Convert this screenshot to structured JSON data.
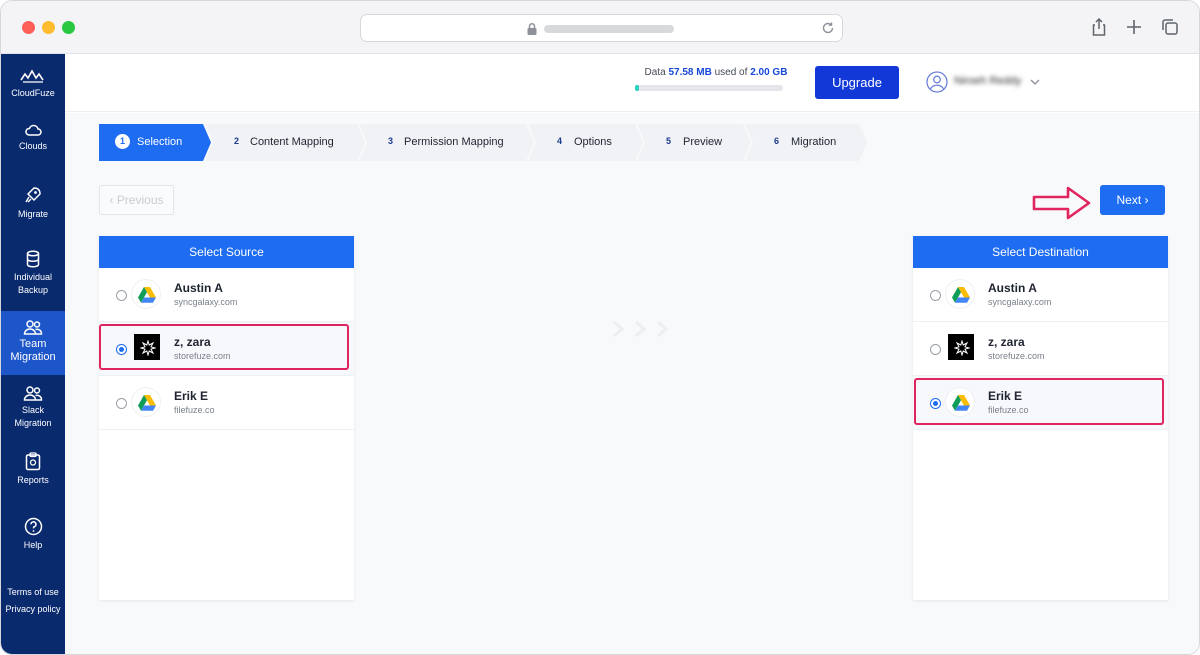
{
  "browser": {
    "traffic_lights": [
      "#fe5f57",
      "#febc2e",
      "#28c840"
    ],
    "icons": [
      "lock-icon",
      "reload-icon",
      "share-icon",
      "plus-icon",
      "tabs-icon"
    ]
  },
  "sidebar": {
    "brand": "CloudFuze",
    "items": [
      {
        "label": "Clouds",
        "icon": "cloud-icon"
      },
      {
        "label": "Migrate",
        "icon": "rocket-icon"
      },
      {
        "label": "Individual Backup",
        "icon": "database-icon"
      },
      {
        "label": "Team Migration",
        "icon": "users-icon",
        "active": true
      },
      {
        "label": "Slack Migration",
        "icon": "users-icon"
      },
      {
        "label": "Reports",
        "icon": "clipboard-icon"
      },
      {
        "label": "Help",
        "icon": "help-icon"
      }
    ],
    "terms": "Terms of use",
    "privacy": "Privacy policy"
  },
  "header": {
    "data_prefix": "Data",
    "data_used": "57.58 MB",
    "data_mid": "used of",
    "data_total": "2.00 GB",
    "usage_fraction": 0.03,
    "upgrade_label": "Upgrade",
    "user_name": "Niroeh Reddy"
  },
  "stepper": {
    "steps": [
      {
        "num": "1",
        "label": "Selection",
        "active": true
      },
      {
        "num": "2",
        "label": "Content Mapping"
      },
      {
        "num": "3",
        "label": "Permission Mapping"
      },
      {
        "num": "4",
        "label": "Options"
      },
      {
        "num": "5",
        "label": "Preview"
      },
      {
        "num": "6",
        "label": "Migration"
      }
    ]
  },
  "nav": {
    "previous_label": "Previous",
    "next_label": "Next"
  },
  "source": {
    "title": "Select Source",
    "rows": [
      {
        "name": "Austin A",
        "domain": "syncgalaxy.com",
        "icon": "google-drive-icon",
        "checked": false
      },
      {
        "name": "z, zara",
        "domain": "storefuze.com",
        "icon": "box-dark-icon",
        "checked": true
      },
      {
        "name": "Erik E",
        "domain": "filefuze.co",
        "icon": "google-drive-icon",
        "checked": false
      }
    ]
  },
  "destination": {
    "title": "Select Destination",
    "rows": [
      {
        "name": "Austin A",
        "domain": "syncgalaxy.com",
        "icon": "google-drive-icon",
        "checked": false
      },
      {
        "name": "z, zara",
        "domain": "storefuze.com",
        "icon": "box-dark-icon",
        "checked": false
      },
      {
        "name": "Erik E",
        "domain": "filefuze.co",
        "icon": "google-drive-icon",
        "checked": true
      }
    ]
  },
  "colors": {
    "sidebar_bg": "#0a2a6e",
    "sidebar_active": "#1d56c9",
    "primary": "#1d6cf2",
    "upgrade": "#1338d8",
    "highlight": "#e0245e"
  }
}
